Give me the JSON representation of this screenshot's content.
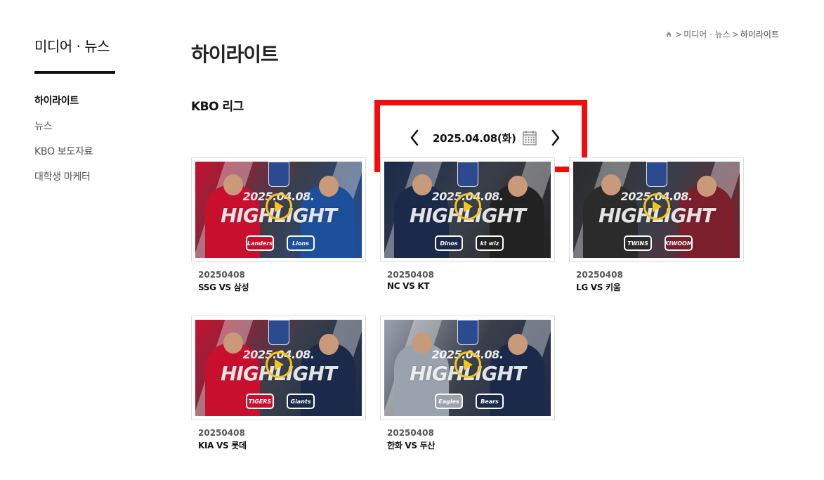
{
  "sidebar": {
    "title": "미디어 · 뉴스",
    "items": [
      {
        "label": "하이라이트",
        "active": true
      },
      {
        "label": "뉴스",
        "active": false
      },
      {
        "label": "KBO 보도자료",
        "active": false
      },
      {
        "label": "대학생 마케터",
        "active": false
      }
    ]
  },
  "breadcrumb": {
    "icon": "home-icon",
    "separator": ">",
    "items": [
      "미디어 · 뉴스",
      "하이라이트"
    ]
  },
  "main": {
    "title": "하이라이트",
    "section": "KBO 리그",
    "date_nav": {
      "date": "2025.04.08(화)",
      "prev_icon": "chevron-left-icon",
      "next_icon": "chevron-right-icon",
      "calendar_icon": "calendar-icon",
      "highlight_color": "#f40b0b"
    },
    "thumb_text": {
      "date": "2025.04.08.",
      "word": "HIGHLIGHT"
    },
    "videos": [
      {
        "date": "20250408",
        "match": "SSG VS 삼성",
        "logos": [
          "Landers",
          "Lions"
        ],
        "colors": [
          "#c8102e",
          "#1c4f9c"
        ]
      },
      {
        "date": "20250408",
        "match": "NC VS KT",
        "logos": [
          "Dinos",
          "kt wiz"
        ],
        "colors": [
          "#1b2a4a",
          "#222222"
        ]
      },
      {
        "date": "20250408",
        "match": "LG VS 키움",
        "logos": [
          "TWINS",
          "KIWOOM"
        ],
        "colors": [
          "#2b2b2b",
          "#7a1f2b"
        ]
      },
      {
        "date": "20250408",
        "match": "KIA VS 롯데",
        "logos": [
          "TIGERS",
          "Giants"
        ],
        "colors": [
          "#c8102e",
          "#1b2a4a"
        ]
      },
      {
        "date": "20250408",
        "match": "한화 VS 두산",
        "logos": [
          "Eagles",
          "Bears"
        ],
        "colors": [
          "#9aa2ad",
          "#1b2a4a"
        ]
      }
    ]
  }
}
